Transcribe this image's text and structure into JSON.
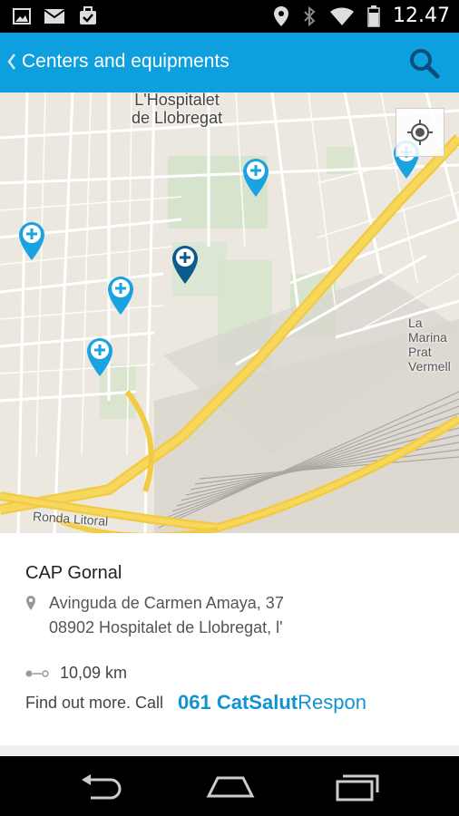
{
  "status_bar": {
    "time": "12.47",
    "icons": [
      "image-icon",
      "gmail-icon",
      "briefcase-icon",
      "location-icon",
      "bluetooth-icon",
      "wifi-icon",
      "battery-icon"
    ]
  },
  "action_bar": {
    "title": "Centers and equipments",
    "back_icon": "chevron-left-icon",
    "search_icon": "search-icon",
    "bg_color": "#0e9fdf"
  },
  "map": {
    "labels": {
      "city_line1": "L'Hospitalet",
      "city_line2": "de Llobregat",
      "road": "Ronda Litoral",
      "area_line1": "La Marina",
      "area_line2": "Prat Vermell"
    },
    "markers": [
      {
        "name": "map-marker",
        "selected": false
      },
      {
        "name": "map-marker",
        "selected": false
      },
      {
        "name": "map-marker",
        "selected": false
      },
      {
        "name": "map-marker",
        "selected": false
      },
      {
        "name": "map-marker",
        "selected": true
      },
      {
        "name": "map-marker",
        "selected": false
      }
    ],
    "marker_color": "#1aa3e0",
    "selected_marker_color": "#0d5a8e"
  },
  "info": {
    "name": "CAP Gornal",
    "address_line1": "Avinguda de Carmen Amaya, 37",
    "address_line2": "08902 Hospitalet de Llobregat, l'",
    "distance": "10,09  km",
    "more_prefix": "Find out more. Call",
    "brand_number": "061",
    "brand_bold": "CatSalut",
    "brand_rest": "Respon",
    "brand_color": "#1193d3"
  },
  "nav_bar": {
    "back": "back-icon",
    "home": "home-icon",
    "recents": "recents-icon"
  }
}
